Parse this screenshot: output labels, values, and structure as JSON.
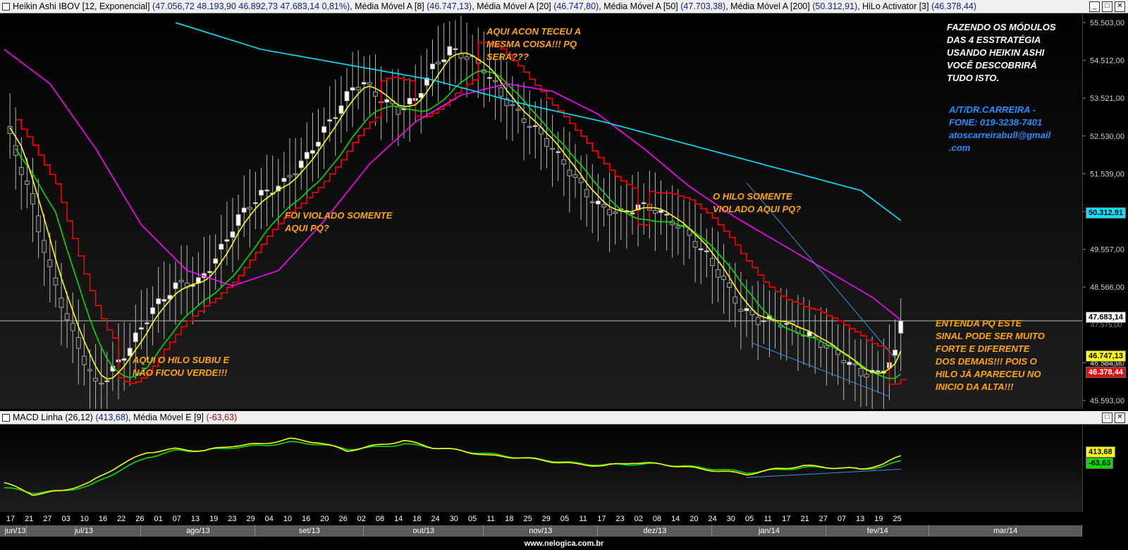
{
  "top_header": {
    "title": "Heikin Ashi IBOV [12, Exponencial]",
    "values": "(47.056,72  48.193,90  46.892,73  47.683,14  0,81%)",
    "ind1": "Média Móvel A [8]",
    "ind1_val": "(46.747,13)",
    "ind2": "Média Móvel A [20]",
    "ind2_val": "(46.747,80)",
    "ind3": "Média Móvel A [50]",
    "ind3_val": "(47.703,38)",
    "ind4": "Média Móvel A [200]",
    "ind4_val": "(50.312,91)",
    "ind5": "HiLo Activator [3]",
    "ind5_val": "(46.378,44)"
  },
  "macd_header": {
    "title": "MACD Linha (26,12)",
    "val": "(413,68)",
    "signal": "Média Móvel E [9]",
    "signal_val": "(-63,63)"
  },
  "window_buttons": {
    "minimize": "_",
    "restore": "□",
    "close": "✕"
  },
  "annotations": {
    "a1": "AQUI O HILO SUBIU E\nNÃO FICOU VERDE!!!",
    "a2": "FOI VIOLADO SOMENTE\nAQUI PQ?",
    "a3": "AQUI ACON TECEU A\nMESMA COISA!!! PQ\nSERÁ???",
    "a4": "O HILO SOMENTE\nVIOLADO AQUI PQ?",
    "a5": "FAZENDO OS MÓDULOS\nDAS 4 ESSTRATÉGIA\nUSANDO HEIKIN ASHI\nVOCÊ DESCOBRIRÁ\nTUDO ISTO.",
    "a6": "A/T/DR.CARREIRA -\nFONE: 019-3238-7401\natoscarreirabull@gmail\n.com",
    "a7": "ENTENDA PQ ESTE\nSINAL PODE SER MUITO\nFORTE E DIFERENTE\nDOS DEMAIS!!! POIS O\nHILO JÁ APARECEU NO\nINICIO DA ALTA!!!"
  },
  "price_tags": {
    "ma200": "50.312,91",
    "last": "47.683,14",
    "ma8": "46.747,13",
    "hilo": "46.378,44",
    "macd": "413,68",
    "signal": "-63,63"
  },
  "hidden_tick_fragments": {
    "under_last": "47.575,00",
    "under_ma8": "46.584,00"
  },
  "footer": "www.nelogica.com.br",
  "colors": {
    "ma8": "#ffff00",
    "ma20": "#00dd00",
    "ma50": "#ff00ff",
    "ma200": "#00e5ff",
    "hilo": "#ff0000",
    "annotation_orange": "#ffa500",
    "annotation_white": "#ffffff",
    "annotation_blue": "#1e90ff",
    "trendline": "#3a8fe0"
  },
  "months": [
    {
      "label": "jun/13",
      "start": 0,
      "end": 4
    },
    {
      "label": "jul/13",
      "start": 4,
      "end": 24
    },
    {
      "label": "ago/13",
      "start": 24,
      "end": 44
    },
    {
      "label": "set/13",
      "start": 44,
      "end": 63
    },
    {
      "label": "out/13",
      "start": 63,
      "end": 84
    },
    {
      "label": "nov/13",
      "start": 84,
      "end": 104
    },
    {
      "label": "dez/13",
      "start": 104,
      "end": 124
    },
    {
      "label": "jan/14",
      "start": 124,
      "end": 144
    },
    {
      "label": "fev/14",
      "start": 144,
      "end": 162
    },
    {
      "label": "mar/14",
      "start": 162,
      "end": 216
    }
  ],
  "chart_data": [
    {
      "type": "candlestick",
      "title": "Heikin Ashi IBOV [12, Exponencial]",
      "x_tick_labels": [
        "17",
        "21",
        "27",
        "03",
        "10",
        "16",
        "22",
        "26",
        "01",
        "07",
        "13",
        "19",
        "23",
        "29",
        "04",
        "10",
        "16",
        "20",
        "26",
        "02",
        "08",
        "14",
        "18",
        "24",
        "30",
        "05",
        "11",
        "18",
        "25",
        "29",
        "05",
        "11",
        "17",
        "23",
        "02",
        "08",
        "14",
        "20",
        "24",
        "30",
        "05",
        "11",
        "17",
        "21",
        "27",
        "07",
        "13",
        "19",
        "25"
      ],
      "y_ticks": [
        "55.503,00",
        "54.512,00",
        "53.521,00",
        "52.530,00",
        "51.539,00",
        "50.548,00",
        "49.557,00",
        "48.566,00",
        "46.584,00",
        "45.593,00"
      ],
      "ylim": [
        45593,
        55503
      ],
      "bars": 178,
      "anchors_close": [
        [
          0,
          52900
        ],
        [
          4,
          51200
        ],
        [
          8,
          49000
        ],
        [
          12,
          47300
        ],
        [
          16,
          46000
        ],
        [
          18,
          46200
        ],
        [
          22,
          47000
        ],
        [
          26,
          48000
        ],
        [
          30,
          48600
        ],
        [
          34,
          48700
        ],
        [
          37,
          49300
        ],
        [
          41,
          50400
        ],
        [
          45,
          51000
        ],
        [
          49,
          51300
        ],
        [
          53,
          52000
        ],
        [
          57,
          52900
        ],
        [
          61,
          53800
        ],
        [
          63,
          53900
        ],
        [
          66,
          53500
        ],
        [
          69,
          53200
        ],
        [
          72,
          53500
        ],
        [
          75,
          54300
        ],
        [
          78,
          54800
        ],
        [
          81,
          54600
        ],
        [
          84,
          54300
        ],
        [
          87,
          53600
        ],
        [
          90,
          53100
        ],
        [
          93,
          52700
        ],
        [
          96,
          52200
        ],
        [
          99,
          51600
        ],
        [
          102,
          51000
        ],
        [
          105,
          50600
        ],
        [
          108,
          50500
        ],
        [
          111,
          50700
        ],
        [
          114,
          50600
        ],
        [
          117,
          50300
        ],
        [
          120,
          49900
        ],
        [
          123,
          49400
        ],
        [
          126,
          48700
        ],
        [
          129,
          48000
        ],
        [
          132,
          47700
        ],
        [
          135,
          47700
        ],
        [
          138,
          47500
        ],
        [
          141,
          47300
        ],
        [
          144,
          47000
        ],
        [
          147,
          46700
        ],
        [
          150,
          46300
        ],
        [
          153,
          46300
        ],
        [
          156,
          46800
        ],
        [
          157,
          47680
        ]
      ],
      "series": [
        {
          "name": "Média Móvel A [8]",
          "line": "ma8",
          "last": 46747.13
        },
        {
          "name": "Média Móvel A [20]",
          "line": "ma20",
          "last": 46747.8
        },
        {
          "name": "Média Móvel A [50]",
          "line": "ma50",
          "last": 47703.38
        },
        {
          "name": "Média Móvel A [200]",
          "line": "ma200",
          "last": 50312.91
        },
        {
          "name": "HiLo Activator [3]",
          "line": "hilo",
          "last": 46378.44
        }
      ],
      "ma200_anchors": [
        [
          30,
          55500
        ],
        [
          45,
          54800
        ],
        [
          60,
          54400
        ],
        [
          75,
          54000
        ],
        [
          90,
          53400
        ],
        [
          105,
          52900
        ],
        [
          120,
          52300
        ],
        [
          135,
          51700
        ],
        [
          150,
          51100
        ],
        [
          157,
          50313
        ]
      ],
      "ma50_anchors": [
        [
          0,
          54800
        ],
        [
          8,
          53900
        ],
        [
          16,
          52200
        ],
        [
          24,
          50200
        ],
        [
          32,
          49000
        ],
        [
          40,
          48600
        ],
        [
          48,
          49000
        ],
        [
          56,
          50300
        ],
        [
          64,
          51800
        ],
        [
          72,
          52900
        ],
        [
          80,
          53600
        ],
        [
          88,
          53900
        ],
        [
          96,
          53700
        ],
        [
          104,
          53100
        ],
        [
          112,
          52200
        ],
        [
          120,
          51200
        ],
        [
          128,
          50400
        ],
        [
          136,
          49700
        ],
        [
          144,
          49000
        ],
        [
          152,
          48300
        ],
        [
          157,
          47703
        ]
      ],
      "trendlines": [
        [
          [
            131,
            47100
          ],
          [
            155,
            45700
          ]
        ],
        [
          [
            130,
            51300
          ],
          [
            156,
            46700
          ]
        ]
      ],
      "last_price_line": 47683.14
    },
    {
      "type": "line",
      "title": "MACD Linha (26,12)",
      "series": [
        {
          "name": "MACD Linha (26,12)",
          "last": 413.68,
          "anchors": [
            [
              0,
              -600
            ],
            [
              5,
              -1300
            ],
            [
              10,
              -1100
            ],
            [
              15,
              -600
            ],
            [
              20,
              400
            ],
            [
              25,
              1200
            ],
            [
              30,
              1400
            ],
            [
              35,
              1300
            ],
            [
              40,
              1600
            ],
            [
              45,
              1700
            ],
            [
              50,
              2000
            ],
            [
              55,
              1800
            ],
            [
              60,
              1300
            ],
            [
              65,
              1600
            ],
            [
              70,
              1900
            ],
            [
              75,
              1500
            ],
            [
              80,
              1300
            ],
            [
              85,
              1000
            ],
            [
              90,
              900
            ],
            [
              95,
              700
            ],
            [
              100,
              500
            ],
            [
              105,
              400
            ],
            [
              110,
              600
            ],
            [
              115,
              500
            ],
            [
              120,
              300
            ],
            [
              125,
              100
            ],
            [
              130,
              -100
            ],
            [
              135,
              200
            ],
            [
              140,
              400
            ],
            [
              145,
              300
            ],
            [
              150,
              200
            ],
            [
              154,
              500
            ],
            [
              157,
              1000
            ]
          ]
        },
        {
          "name": "Média Móvel E [9]",
          "last": -63.63,
          "anchors": [
            [
              0,
              -900
            ],
            [
              5,
              -1200
            ],
            [
              10,
              -1100
            ],
            [
              15,
              -800
            ],
            [
              20,
              100
            ],
            [
              25,
              900
            ],
            [
              30,
              1300
            ],
            [
              35,
              1300
            ],
            [
              40,
              1500
            ],
            [
              45,
              1600
            ],
            [
              50,
              1800
            ],
            [
              55,
              1700
            ],
            [
              60,
              1400
            ],
            [
              65,
              1500
            ],
            [
              70,
              1700
            ],
            [
              75,
              1500
            ],
            [
              80,
              1300
            ],
            [
              85,
              1100
            ],
            [
              90,
              900
            ],
            [
              95,
              750
            ],
            [
              100,
              550
            ],
            [
              105,
              450
            ],
            [
              110,
              500
            ],
            [
              115,
              500
            ],
            [
              120,
              350
            ],
            [
              125,
              200
            ],
            [
              130,
              0
            ],
            [
              135,
              150
            ],
            [
              140,
              300
            ],
            [
              145,
              300
            ],
            [
              150,
              200
            ],
            [
              154,
              350
            ],
            [
              157,
              700
            ]
          ]
        }
      ],
      "ylim": [
        -1800,
        2400
      ],
      "trendline": [
        [
          130,
          -300
        ],
        [
          157,
          200
        ]
      ]
    }
  ]
}
